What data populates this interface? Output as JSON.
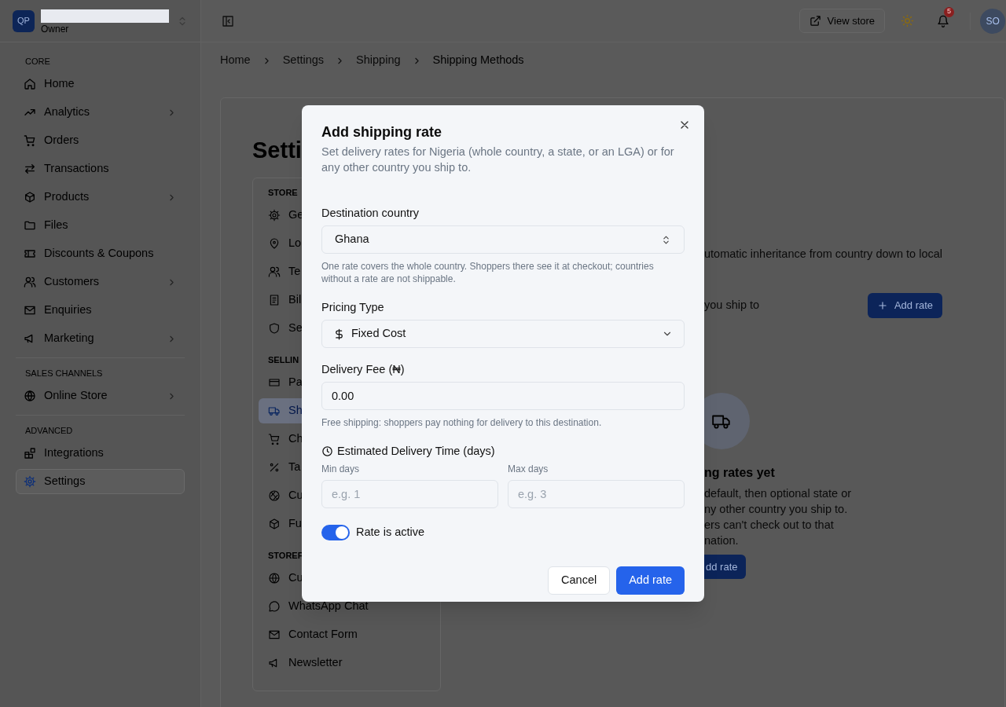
{
  "sidebar": {
    "logo": "QP",
    "role": "Owner",
    "sections": [
      {
        "heading": "CORE",
        "items": [
          {
            "label": "Home",
            "submenu": false,
            "selected": false
          },
          {
            "label": "Analytics",
            "submenu": true,
            "selected": false
          },
          {
            "label": "Orders",
            "submenu": false,
            "selected": false
          },
          {
            "label": "Transactions",
            "submenu": false,
            "selected": false
          },
          {
            "label": "Products",
            "submenu": true,
            "selected": false
          },
          {
            "label": "Files",
            "submenu": false,
            "selected": false
          },
          {
            "label": "Discounts & Coupons",
            "submenu": false,
            "selected": false
          },
          {
            "label": "Customers",
            "submenu": true,
            "selected": false
          },
          {
            "label": "Enquiries",
            "submenu": false,
            "selected": false
          },
          {
            "label": "Marketing",
            "submenu": true,
            "selected": false
          }
        ]
      },
      {
        "heading": "SALES CHANNELS",
        "items": [
          {
            "label": "Online Store",
            "submenu": true,
            "selected": false
          }
        ]
      },
      {
        "heading": "ADVANCED",
        "items": [
          {
            "label": "Integrations",
            "submenu": false,
            "selected": false
          },
          {
            "label": "Settings",
            "submenu": false,
            "selected": true
          }
        ]
      }
    ]
  },
  "header": {
    "view_store": "View store",
    "notifications": "5",
    "avatar": "SO"
  },
  "breadcrumb": [
    "Home",
    "Settings",
    "Shipping",
    "Shipping Methods"
  ],
  "page": {
    "title": "Setti",
    "settings_nav": [
      {
        "heading": "STORE",
        "items": [
          {
            "label": "Ge",
            "selected": false
          },
          {
            "label": "Lo",
            "selected": false
          },
          {
            "label": "Te",
            "selected": false
          },
          {
            "label": "Bil",
            "selected": false
          },
          {
            "label": "Se",
            "selected": false
          }
        ]
      },
      {
        "heading": "SELLIN",
        "items": [
          {
            "label": "Pa",
            "selected": false
          },
          {
            "label": "Sh",
            "selected": true
          },
          {
            "label": "Ch",
            "selected": false
          },
          {
            "label": "Ta",
            "selected": false
          },
          {
            "label": "Cu",
            "selected": false
          },
          {
            "label": "Fu",
            "selected": false
          }
        ]
      },
      {
        "heading": "STOREF",
        "items": [
          {
            "label": "Cu",
            "selected": false
          },
          {
            "label": "WhatsApp Chat",
            "selected": false
          },
          {
            "label": "Contact Form",
            "selected": false
          },
          {
            "label": "Newsletter",
            "selected": false
          }
        ]
      }
    ],
    "content": {
      "description": "utomatic inheritance from country down to local",
      "list_text": "you ship to",
      "add_button": "Add rate",
      "empty_state": {
        "title": "ng rates yet",
        "lines": [
          "default, then optional state or",
          "ny other country you ship to.",
          "ers can't check out to that",
          "nation."
        ],
        "button": "dd rate"
      }
    }
  },
  "modal": {
    "title": "Add shipping rate",
    "description": "Set delivery rates for Nigeria (whole country, a state, or an LGA) or for any other country you ship to.",
    "country": {
      "label": "Destination country",
      "value": "Ghana",
      "help": "One rate covers the whole country. Shoppers there see it at checkout; countries without a rate are not shippable."
    },
    "pricing": {
      "label": "Pricing Type",
      "value": "Fixed Cost"
    },
    "fee": {
      "label": "Delivery Fee (₦)",
      "value": "0.00",
      "help": "Free shipping: shoppers pay nothing for delivery to this destination."
    },
    "delivery_time": {
      "label": "Estimated Delivery Time (days)",
      "min_label": "Min days",
      "min_placeholder": "e.g. 1",
      "max_label": "Max days",
      "max_placeholder": "e.g. 3"
    },
    "active": {
      "label": "Rate is active",
      "on": true
    },
    "buttons": {
      "cancel": "Cancel",
      "submit": "Add rate"
    }
  }
}
